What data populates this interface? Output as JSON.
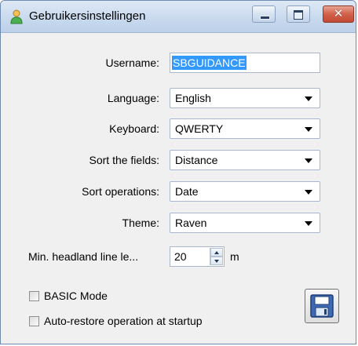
{
  "window": {
    "title": "Gebruikersinstellingen",
    "icon": "user-icon",
    "controls": [
      "minimize-icon",
      "maximize-icon",
      "close-icon"
    ]
  },
  "form": {
    "username": {
      "label": "Username:",
      "value": "SBGUIDANCE"
    },
    "language": {
      "label": "Language:",
      "value": "English"
    },
    "keyboard": {
      "label": "Keyboard:",
      "value": "QWERTY"
    },
    "sort_fields": {
      "label": "Sort the fields:",
      "value": "Distance"
    },
    "sort_operations": {
      "label": "Sort operations:",
      "value": "Date"
    },
    "theme": {
      "label": "Theme:",
      "value": "Raven"
    },
    "min_headland": {
      "label": "Min. headland line le...",
      "value": "20",
      "unit": "m"
    }
  },
  "options": {
    "basic_mode": {
      "label": "BASIC Mode",
      "checked": false
    },
    "auto_restore": {
      "label": "Auto-restore operation at startup",
      "checked": false
    }
  },
  "save_button": {
    "icon": "floppy-disk-icon"
  },
  "colors": {
    "selection": "#3399ff",
    "titlebar": "#c9daee",
    "close": "#d2604a"
  }
}
